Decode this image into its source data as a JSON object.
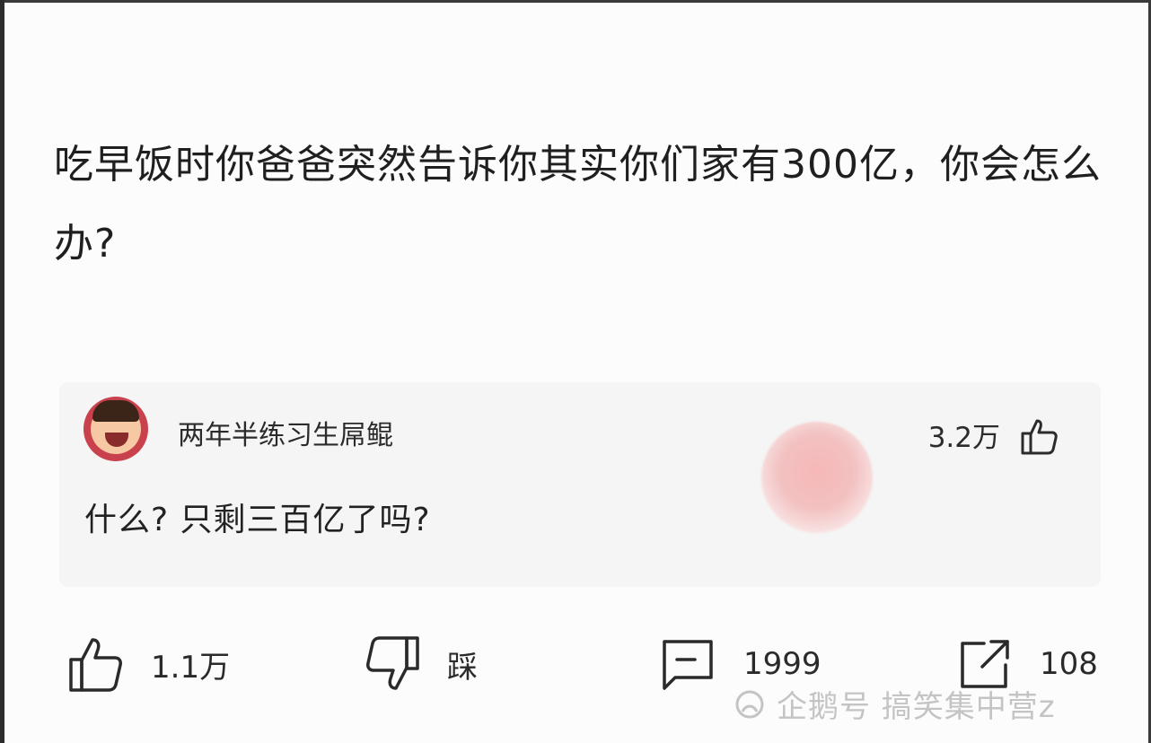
{
  "question": {
    "text": "吃早饭时你爸爸突然告诉你其实你们家有300亿，你会怎么办?"
  },
  "answer": {
    "author_name": "两年半练习生屌鲲",
    "like_count": "3.2万",
    "text": "什么? 只剩三百亿了吗?"
  },
  "toolbar": {
    "like_count": "1.1万",
    "dislike_label": "踩",
    "comment_count": "1999",
    "share_count": "108"
  },
  "watermark": {
    "text": "企鹅号 搞笑集中营z"
  },
  "icons": {
    "like": "thumbs-up-icon",
    "dislike": "thumbs-down-icon",
    "comment": "comment-icon",
    "share": "share-icon",
    "watermark_logo": "penguin-logo-icon"
  },
  "colors": {
    "background": "#fcfcfc",
    "card_background": "#f5f5f5",
    "text_primary": "#1f1f1f",
    "avatar_bg": "#c9414c"
  }
}
